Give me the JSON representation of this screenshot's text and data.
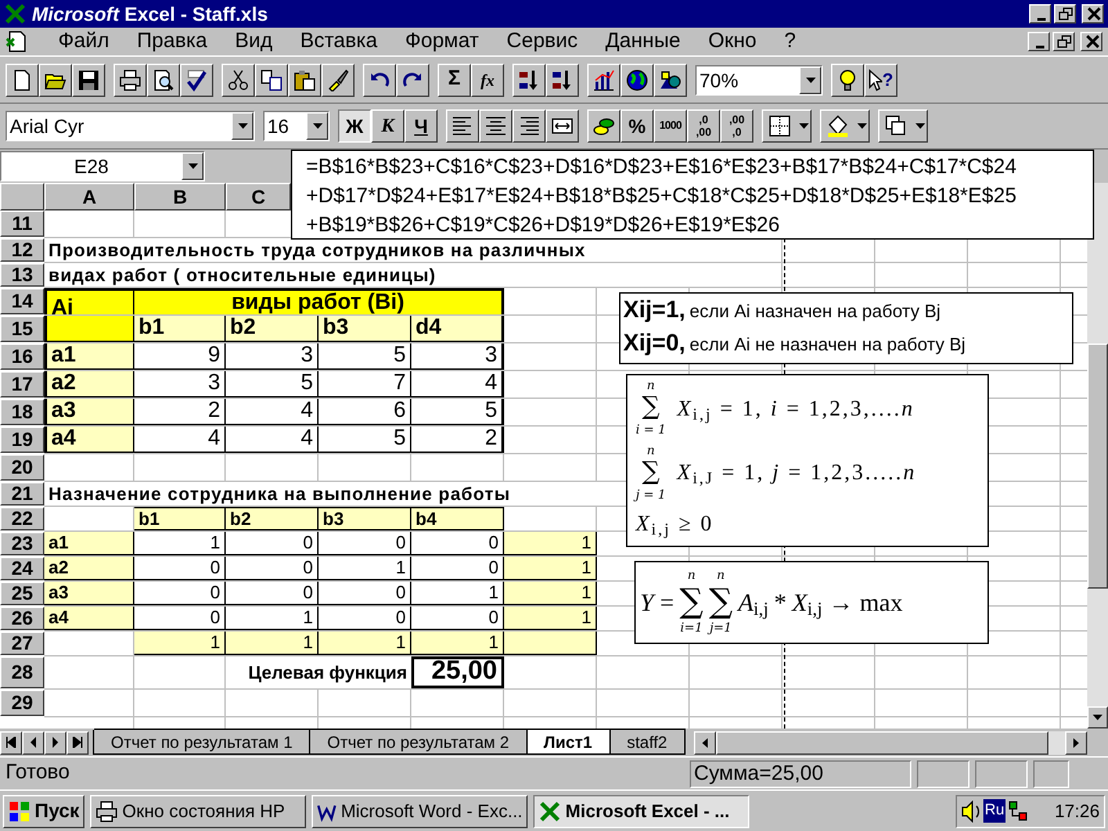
{
  "window": {
    "title": "*Microsoft* Excel - Staff.xls"
  },
  "menu": [
    "Файл",
    "Правка",
    "Вид",
    "Вставка",
    "Формат",
    "Сервис",
    "Данные",
    "Окно",
    "?"
  ],
  "toolbar_standard": {
    "sum": "Σ",
    "function": "fx",
    "help": "?",
    "zoom": "70%"
  },
  "toolbar_formatting": {
    "font": "Arial Cyr",
    "size": "16",
    "styles": [
      {
        "text": "Ж",
        "selected": true
      },
      {
        "text": "К",
        "selected": false
      },
      {
        "text": "Ч",
        "selected": false
      }
    ],
    "percent": "%",
    "thousands": "1000",
    "decimals": [
      {
        "top": ",0",
        "bottom": ",00"
      },
      {
        "top": ",00",
        "bottom": ",0"
      }
    ]
  },
  "name_box": "E28",
  "formula": "=B$16*B$23+C$16*C$23+D$16*D$23+E$16*E$23+B$17*B$24+C$17*C$24+D$17*D$24+E$17*E$24+B$18*B$25+C$18*C$25+D$18*D$25+E$18*E$25+B$19*B$26+C$19*C$26+D$19*D$26+E$19*E$26",
  "columns": [
    "A",
    "B",
    "C"
  ],
  "rows": [
    {
      "number": "11",
      "kind": "blank"
    },
    {
      "number": "12",
      "kind": "title",
      "text": "Производительность труда сотрудников на различных"
    },
    {
      "number": "13",
      "kind": "title",
      "text": "видах работ ( относительные единицы)"
    },
    {
      "number": "14",
      "kind": "group_header",
      "label": "Ai",
      "group": "виды работ (Bi)"
    },
    {
      "number": "15",
      "kind": "sub_header",
      "headers": [
        "b1",
        "b2",
        "b3",
        "d4"
      ]
    },
    {
      "number": "16",
      "kind": "data",
      "label": "a1",
      "values": [
        "9",
        "3",
        "5",
        "3"
      ]
    },
    {
      "number": "17",
      "kind": "data",
      "label": "a2",
      "values": [
        "3",
        "5",
        "7",
        "4"
      ]
    },
    {
      "number": "18",
      "kind": "data",
      "label": "a3",
      "values": [
        "2",
        "4",
        "6",
        "5"
      ]
    },
    {
      "number": "19",
      "kind": "data",
      "label": "a4",
      "values": [
        "4",
        "4",
        "5",
        "2"
      ]
    },
    {
      "number": "20",
      "kind": "blank"
    },
    {
      "number": "21",
      "kind": "title",
      "text": "Назначение сотрудника на выполнение работы"
    },
    {
      "number": "22",
      "kind": "column_header",
      "headers": [
        "b1",
        "b2",
        "b3",
        "b4"
      ]
    },
    {
      "number": "23",
      "kind": "assignment",
      "label": "a1",
      "values": [
        "1",
        "0",
        "0",
        "0"
      ],
      "total": "1"
    },
    {
      "number": "24",
      "kind": "assignment",
      "label": "a2",
      "values": [
        "0",
        "0",
        "1",
        "0"
      ],
      "total": "1"
    },
    {
      "number": "25",
      "kind": "assignment",
      "label": "a3",
      "values": [
        "0",
        "0",
        "0",
        "1"
      ],
      "total": "1"
    },
    {
      "number": "26",
      "kind": "assignment",
      "label": "a4",
      "values": [
        "0",
        "1",
        "0",
        "0"
      ],
      "total": "1"
    },
    {
      "number": "27",
      "kind": "totals",
      "values": [
        "1",
        "1",
        "1",
        "1"
      ]
    },
    {
      "number": "28",
      "kind": "result",
      "caption": "Целевая функция",
      "value": "25,00",
      "selected": true
    },
    {
      "number": "29",
      "kind": "blank"
    }
  ],
  "definitions": [
    {
      "term": "Xij=1,",
      "text": "если Ai назначен на работу Bj"
    },
    {
      "term": "Xij=0,",
      "text": "если Ai не назначен на работу Bj"
    }
  ],
  "constraints": [
    {
      "kind": "sum",
      "upper": "n",
      "symbol": "∑",
      "lower": "i = 1",
      "expr": "*X*$_{i,j}$ = 1, *i* = 1,2,3,....*n*"
    },
    {
      "kind": "sum",
      "upper": "n",
      "symbol": "∑",
      "lower": "j = 1",
      "expr": "*X*$_{i,J}$ = 1, *j* = 1,2,3.....*n*"
    },
    {
      "kind": "plain",
      "expr": "*X*$_{i,j}$ ≥ 0"
    }
  ],
  "objective": [
    {
      "kind": "text",
      "text": "*Y* ="
    },
    {
      "kind": "sum",
      "upper": "n",
      "symbol": "∑",
      "lower": "i=1"
    },
    {
      "kind": "sum",
      "upper": "n",
      "symbol": "∑",
      "lower": "j=1"
    },
    {
      "kind": "text",
      "text": "*A*$_{i,j}$"
    },
    {
      "kind": "op",
      "text": "*"
    },
    {
      "kind": "text",
      "text": "*X*$_{i,j}$ → max"
    }
  ],
  "sheet_tabs": [
    {
      "label": "Отчет по результатам 1",
      "selected": false
    },
    {
      "label": "Отчет по результатам 2",
      "selected": false
    },
    {
      "label": "Лист1",
      "selected": true
    },
    {
      "label": "staff2",
      "selected": false
    }
  ],
  "status_bar": {
    "text": "Готово",
    "sum": "Сумма=25,00"
  },
  "taskbar": {
    "start": "Пуск",
    "tasks": [
      {
        "label": "Окно состояния HP",
        "selected": false
      },
      {
        "label": "Microsoft Word - Exc...",
        "selected": false
      },
      {
        "label": "Microsoft Excel - ...",
        "selected": true
      }
    ],
    "language": "Ru",
    "clock": "17:26"
  }
}
